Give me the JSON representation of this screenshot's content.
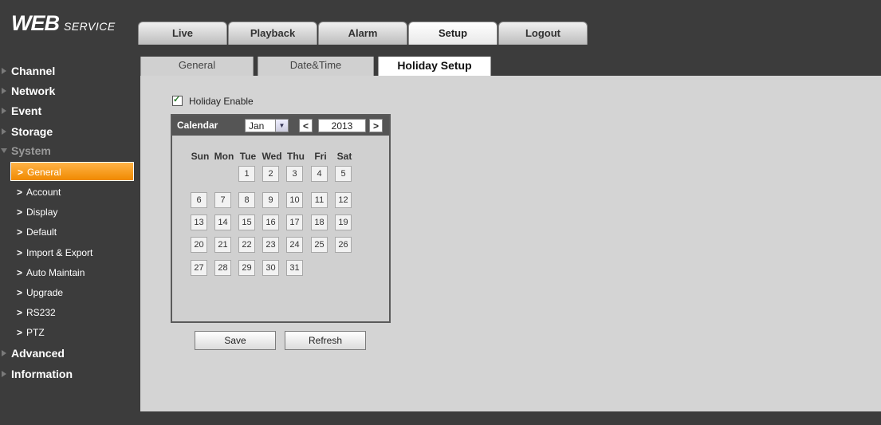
{
  "logo": {
    "main": "WEB",
    "sub": "SERVICE"
  },
  "top_nav": [
    "Live",
    "Playback",
    "Alarm",
    "Setup",
    "Logout"
  ],
  "top_nav_active": "Setup",
  "sidebar": {
    "sections": [
      "Channel",
      "Network",
      "Event",
      "Storage",
      "System",
      "Advanced",
      "Information"
    ],
    "system_items": [
      "General",
      "Account",
      "Display",
      "Default",
      "Import & Export",
      "Auto Maintain",
      "Upgrade",
      "RS232",
      "PTZ"
    ],
    "active_item": "General"
  },
  "sub_tabs": [
    "General",
    "Date&Time",
    "Holiday Setup"
  ],
  "sub_tab_active": "Holiday Setup",
  "holiday_enable": {
    "label": "Holiday Enable",
    "checked": true
  },
  "calendar": {
    "title": "Calendar",
    "month": "Jan",
    "year": "2013",
    "prev": "<",
    "next": ">",
    "weekdays": [
      "Sun",
      "Mon",
      "Tue",
      "Wed",
      "Thu",
      "Fri",
      "Sat"
    ],
    "days": [
      "1",
      "2",
      "3",
      "4",
      "5",
      "6",
      "7",
      "8",
      "9",
      "10",
      "11",
      "12",
      "13",
      "14",
      "15",
      "16",
      "17",
      "18",
      "19",
      "20",
      "21",
      "22",
      "23",
      "24",
      "25",
      "26",
      "27",
      "28",
      "29",
      "30",
      "31"
    ]
  },
  "buttons": {
    "save": "Save",
    "refresh": "Refresh"
  },
  "colors": {
    "accent": "#f08a00",
    "frame": "#3c3c3c",
    "panel": "#d4d4d4"
  }
}
